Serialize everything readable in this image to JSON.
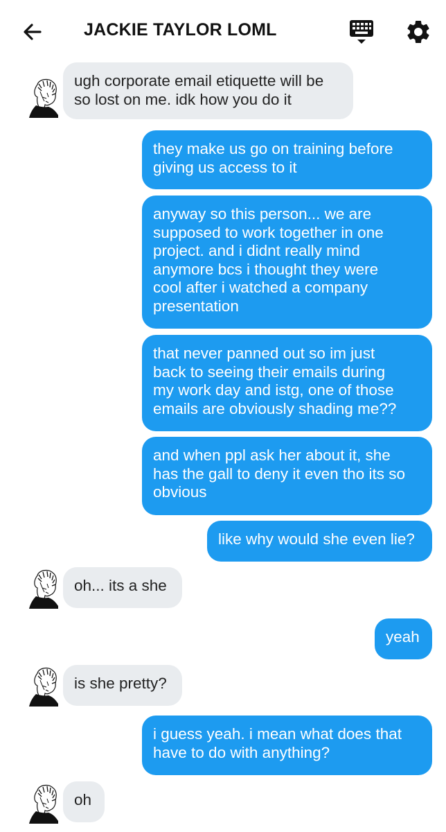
{
  "header": {
    "title": "JACKIE TAYLOR LOML",
    "back_icon": "arrow-left-icon",
    "keyboard_icon": "keyboard-icon",
    "settings_icon": "gear-icon"
  },
  "colors": {
    "incoming_bubble": "#e9ecef",
    "outgoing_bubble": "#1d9bf0",
    "outgoing_text": "#ffffff",
    "incoming_text": "#222222"
  },
  "messages": [
    {
      "from": "them",
      "text": "ugh corporate email etiquette will be\nso lost on me. idk how you do it"
    },
    {
      "from": "me",
      "text": "they make us go on training before\ngiving us access to it"
    },
    {
      "from": "me",
      "text": "anyway so this person... we are\nsupposed to work together in one\nproject. and i didnt really mind\nanymore bcs i thought they were\ncool after i watched a company\npresentation"
    },
    {
      "from": "me",
      "text": "that never panned out so im just\nback to seeing their emails during\nmy work day and istg, one of those\nemails are obviously shading me??"
    },
    {
      "from": "me",
      "text": "and when ppl ask her about it, she\nhas the gall to deny it even tho its so\nobvious"
    },
    {
      "from": "me",
      "text": "like why would she even lie?"
    },
    {
      "from": "them",
      "text": "oh... its a she"
    },
    {
      "from": "me",
      "text": "yeah"
    },
    {
      "from": "them",
      "text": "is she pretty?"
    },
    {
      "from": "me",
      "text": "i guess yeah. i mean what does that\nhave to do with anything?"
    },
    {
      "from": "them",
      "text": "oh"
    }
  ]
}
